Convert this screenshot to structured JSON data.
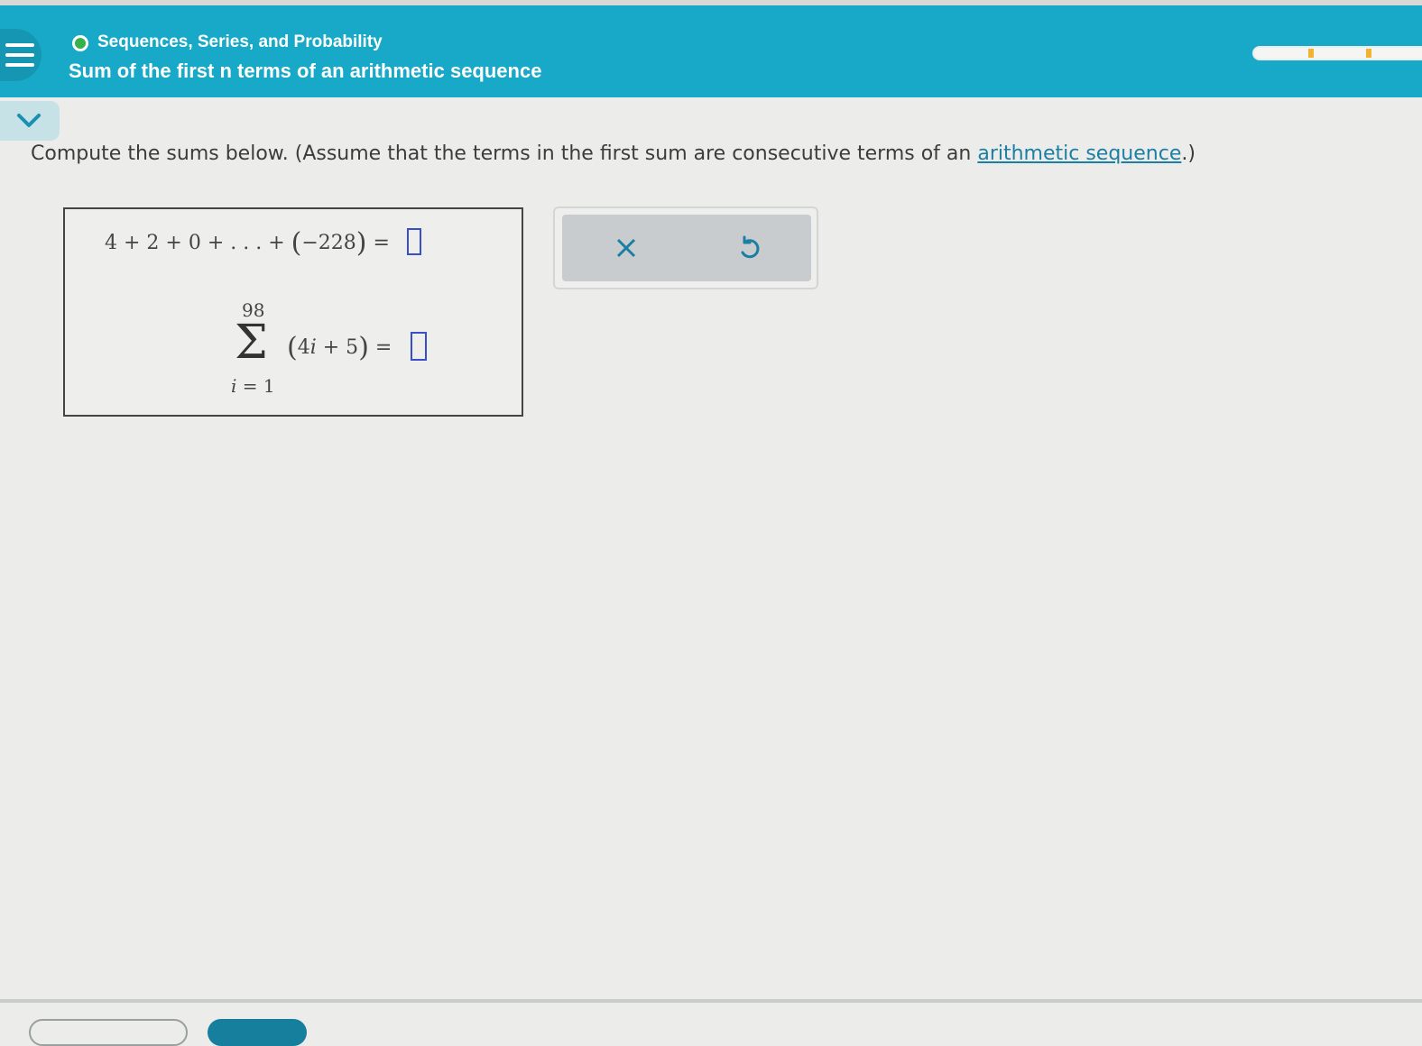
{
  "header": {
    "topic": "Sequences, Series, and Probability",
    "title": "Sum of the first n terms of an arithmetic sequence",
    "progress_segments_completed": 2,
    "accent_color": "#17a9c7",
    "status_color": "#36b24a"
  },
  "question": {
    "prompt_before_link": "Compute the sums below. (Assume that the terms in the first sum are consecutive terms of an ",
    "link_text": "arithmetic sequence",
    "prompt_after_link": ".)"
  },
  "math": {
    "eq1_lhs": "4 + 2 + 0 + . . . + ",
    "eq1_inner": "−228",
    "eq1_equals": "=",
    "sum_upper": "98",
    "sum_lower_var": "i",
    "sum_lower_rest": " = 1",
    "sigma": "Σ",
    "eq2_term_a": "4",
    "eq2_term_var": "i",
    "eq2_term_b": " + 5",
    "eq2_equals": "=",
    "answer1": "",
    "answer2": ""
  },
  "actions": {
    "clear_icon": "close-icon",
    "undo_icon": "undo-icon"
  }
}
